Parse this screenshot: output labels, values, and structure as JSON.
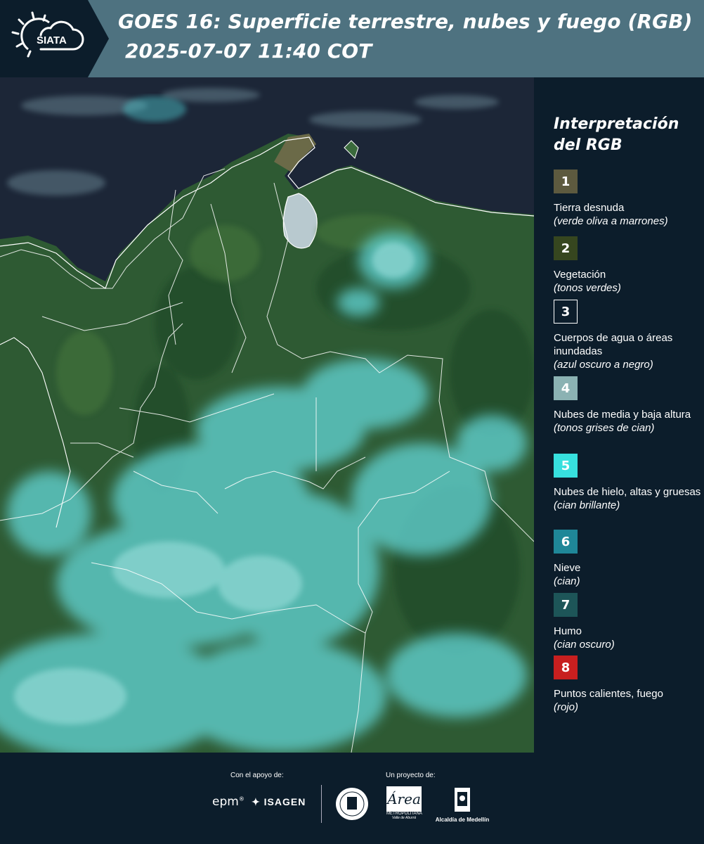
{
  "header": {
    "logo_text": "SIATA",
    "title_line1": "GOES 16: Superficie terrestre, nubes y fuego (RGB)",
    "title_line2": "2025-07-07 11:40 COT"
  },
  "legend": {
    "title": "Interpretación del RGB",
    "items": [
      {
        "number": "1",
        "color": "#5d5a3f",
        "label": "Tierra desnuda",
        "desc": "(verde oliva a marrones)"
      },
      {
        "number": "2",
        "color": "#36461f",
        "label": "Vegetación",
        "desc": "(tonos verdes)"
      },
      {
        "number": "3",
        "color": "#0c1d2b",
        "label": "Cuerpos de agua o áreas inundadas",
        "desc": "(azul oscuro a negro)"
      },
      {
        "number": "4",
        "color": "#8bb2b3",
        "label": "Nubes de media y baja altura",
        "desc": "(tonos grises de cian)"
      },
      {
        "number": "5",
        "color": "#37e0de",
        "label": "Nubes de hielo, altas y gruesas",
        "desc": "(cian brillante)"
      },
      {
        "number": "6",
        "color": "#1f8798",
        "label": "Nieve",
        "desc": "(cian)"
      },
      {
        "number": "7",
        "color": "#1d5558",
        "label": "Humo",
        "desc": "(cian oscuro)"
      },
      {
        "number": "8",
        "color": "#c81f1f",
        "label": "Puntos calientes, fuego",
        "desc": "(rojo)"
      }
    ]
  },
  "footer": {
    "support_label": "Con el apoyo de:",
    "project_label": "Un proyecto de:",
    "epm": "epm",
    "isagen": "ISAGEN",
    "area_metropolitana": "METROPOLITANA",
    "area_sub": "Valle de Aburrá",
    "alcaldia": "Alcaldía de Medellín"
  }
}
